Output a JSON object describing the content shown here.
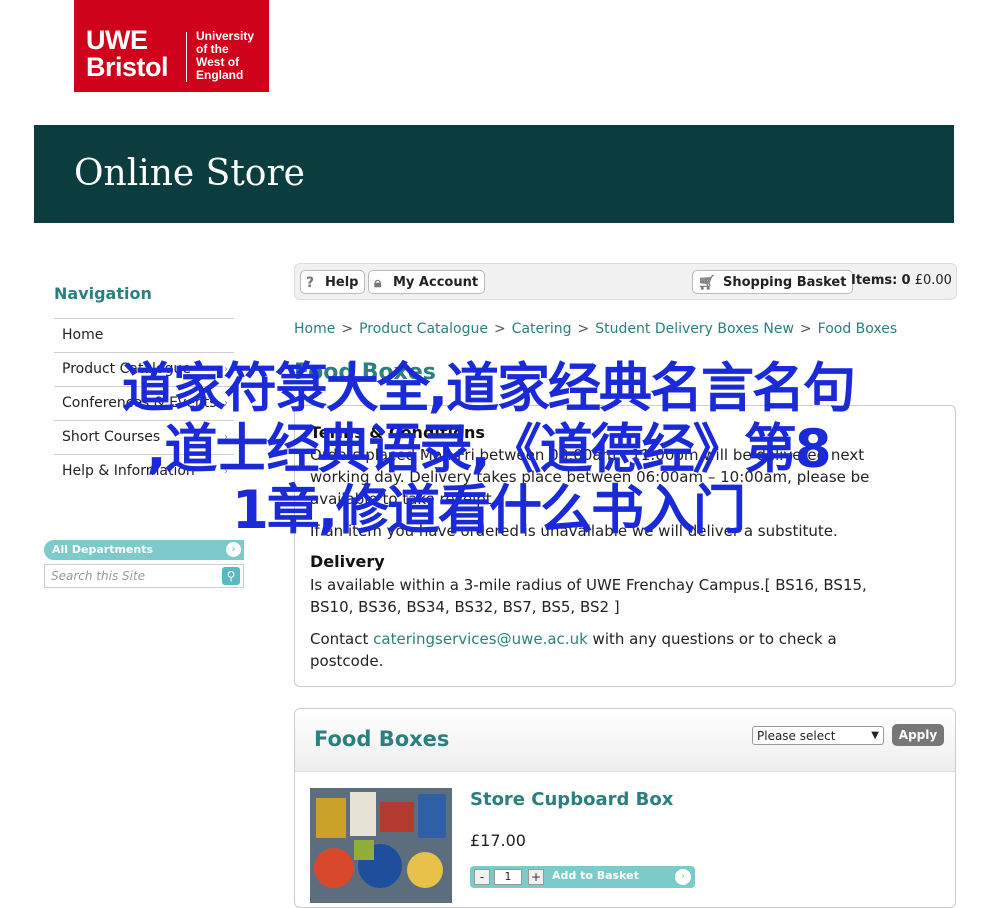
{
  "logo": {
    "uwe": "UWE",
    "bristol": "Bristol",
    "university": [
      "University",
      "of the",
      "West of",
      "England"
    ],
    "color": "#d0021b"
  },
  "banner": {
    "title": "Online Store",
    "color": "#0c3d3e"
  },
  "sidebar": {
    "title": "Navigation",
    "items": [
      {
        "label": "Home"
      },
      {
        "label": "Product Catalogue"
      },
      {
        "label": "Conferences & Events"
      },
      {
        "label": "Short Courses"
      },
      {
        "label": "Help & Information"
      }
    ],
    "departments": "All Departments",
    "search_placeholder": "Search this Site"
  },
  "topbar": {
    "help": "Help",
    "account": "My Account",
    "basket": "Shopping Basket",
    "items_label": "Items:",
    "items_count": "0",
    "items_total": "£0.00"
  },
  "breadcrumb": [
    "Home",
    "Product Catalogue",
    "Catering",
    "Student Delivery Boxes New",
    "Food Boxes"
  ],
  "page": {
    "title": "Food Boxes"
  },
  "terms": {
    "heading": "Terms & Conditions",
    "line1": "Orders placed Mon-Fri between 08:00am - 11:00pm will be delivered next",
    "line2": "working day. Delivery takes place between 06:00am – 10:00am, please be",
    "line3": "available to take receipt.",
    "line4": "If an item you have ordered is unavailable we will deliver a substitute.",
    "delivery_heading": "Delivery",
    "delivery_line1": "Is available within a 3-mile radius of UWE Frenchay Campus.[ BS16, BS15,",
    "delivery_line2": "BS10, BS36, BS34, BS32, BS7, BS5, BS2 ]",
    "contact_prefix": "Contact ",
    "contact_email": "cateringservices@uwe.ac.uk",
    "contact_suffix": " with any questions or to check a",
    "contact_line2": "postcode."
  },
  "foodboxes": {
    "title": "Food Boxes",
    "select_value": "Please select",
    "apply": "Apply",
    "product": {
      "name": "Store Cupboard Box",
      "price": "£17.00",
      "qty": "1",
      "add_label": "Add to Basket"
    }
  },
  "overlay": {
    "line1": "道家符箓大全,道家经典名言名句",
    "line2": ",道士经典语录,《道德经》第8",
    "line3": "1章,修道看什么书入门"
  },
  "accent": "#2a7f7f"
}
